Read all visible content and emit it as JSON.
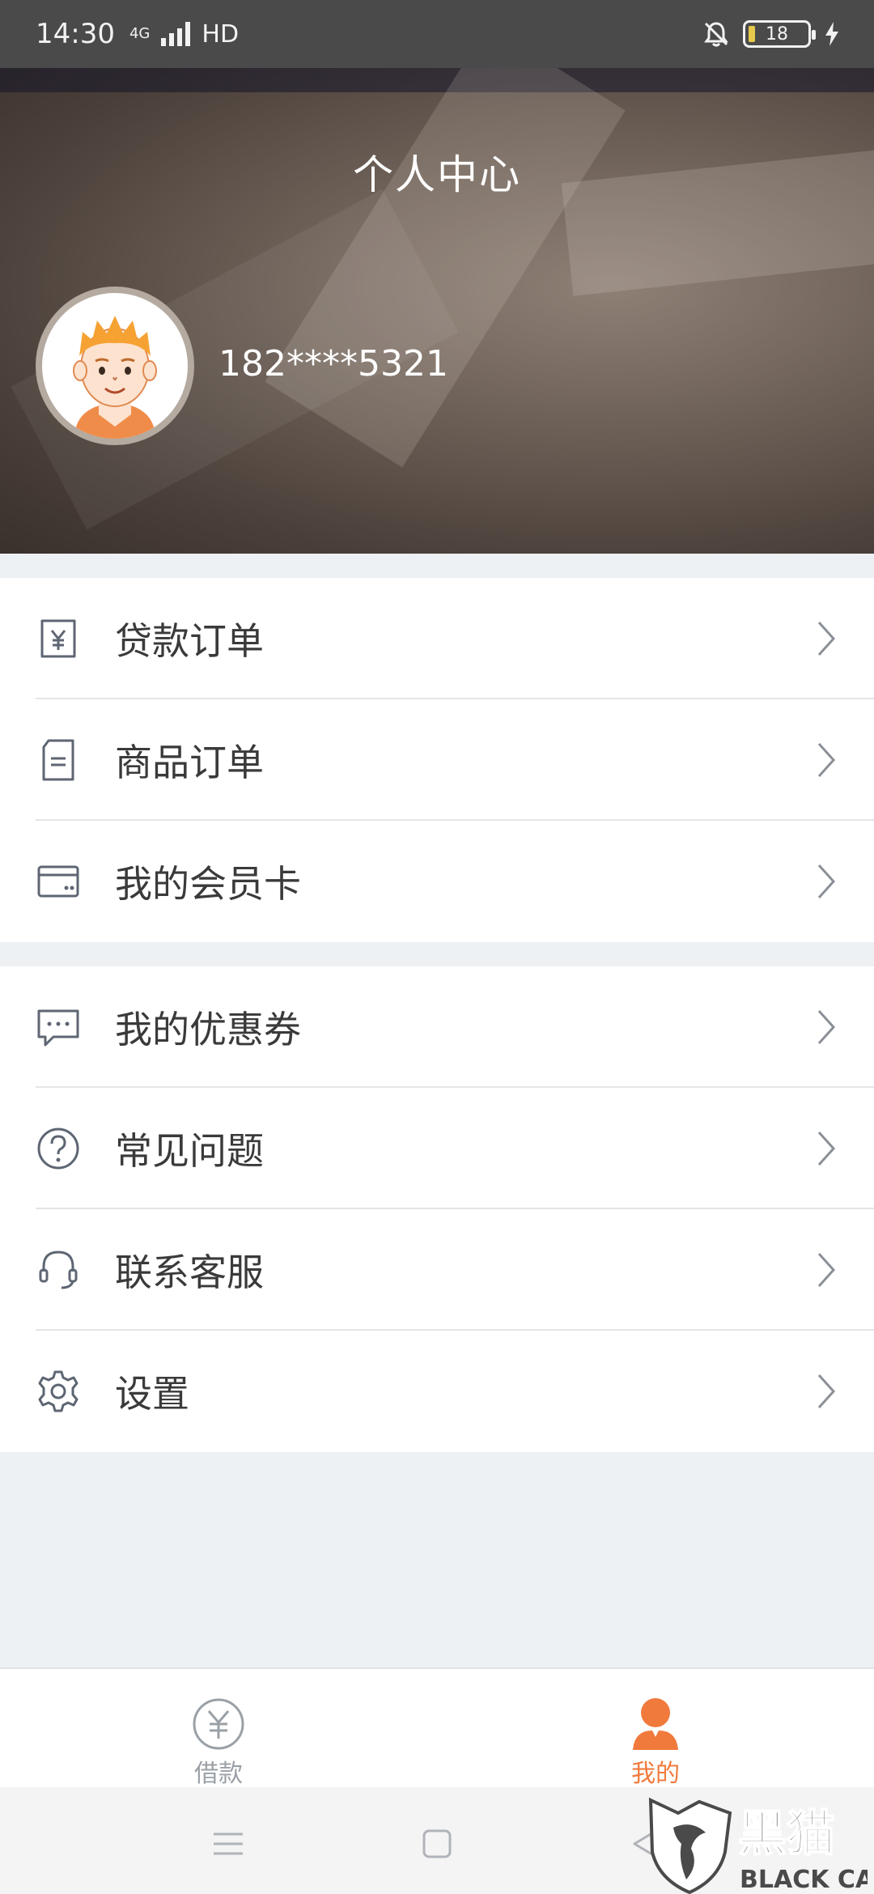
{
  "status_bar": {
    "time": "14:30",
    "network": "4G",
    "hd": "HD",
    "battery": "18"
  },
  "header": {
    "title": "个人中心",
    "phone": "182****5321"
  },
  "menu_group_1": [
    {
      "label": "贷款订单",
      "icon": "yuan-receipt-icon"
    },
    {
      "label": "商品订单",
      "icon": "document-icon"
    },
    {
      "label": "我的会员卡",
      "icon": "card-icon"
    }
  ],
  "menu_group_2": [
    {
      "label": "我的优惠券",
      "icon": "chat-coupon-icon"
    },
    {
      "label": "常见问题",
      "icon": "question-icon"
    },
    {
      "label": "联系客服",
      "icon": "headset-icon"
    },
    {
      "label": "设置",
      "icon": "gear-icon"
    }
  ],
  "tabbar": {
    "tabs": [
      {
        "label": "借款",
        "icon": "yuan-circle-icon",
        "active": false
      },
      {
        "label": "我的",
        "icon": "person-icon",
        "active": true
      }
    ]
  },
  "watermark": {
    "cn": "黑猫",
    "en": "BLACK CAT"
  },
  "colors": {
    "accent": "#f07a3c",
    "icon_gray": "#5e6673",
    "text": "#3a3a3a",
    "inactive_tab": "#9aa0a6"
  }
}
